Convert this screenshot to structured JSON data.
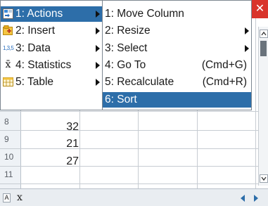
{
  "main_menu": {
    "items": [
      {
        "label": "1: Actions",
        "icon": "actions-icon"
      },
      {
        "label": "2: Insert",
        "icon": "insert-icon"
      },
      {
        "label": "3: Data",
        "icon": "data-icon",
        "icon_text": "1,3,5"
      },
      {
        "label": "4: Statistics",
        "icon": "statistics-icon",
        "icon_text": "x̄"
      },
      {
        "label": "5: Table",
        "icon": "table-icon"
      }
    ],
    "highlighted_index": 0
  },
  "sub_menu": {
    "items": [
      {
        "label": "1: Move Column",
        "shortcut": ""
      },
      {
        "label": "2: Resize",
        "shortcut": ""
      },
      {
        "label": "3: Select",
        "shortcut": ""
      },
      {
        "label": "4: Go To",
        "shortcut": "(Cmd+G)"
      },
      {
        "label": "5: Recalculate",
        "shortcut": "(Cmd+R)"
      },
      {
        "label": "6: Sort",
        "shortcut": ""
      }
    ],
    "highlighted_index": 5
  },
  "sheet": {
    "rows": [
      {
        "row": "8",
        "value": "32"
      },
      {
        "row": "9",
        "value": "21"
      },
      {
        "row": "10",
        "value": "27"
      },
      {
        "row": "11",
        "value": ""
      }
    ]
  },
  "window": {
    "close_label": "✕"
  },
  "formula_bar": {
    "cell_ref": "A",
    "entry": "x"
  },
  "colors": {
    "highlight": "#2d6ea9",
    "close": "#d9342b",
    "nav_arrow": "#2d6ea9"
  }
}
